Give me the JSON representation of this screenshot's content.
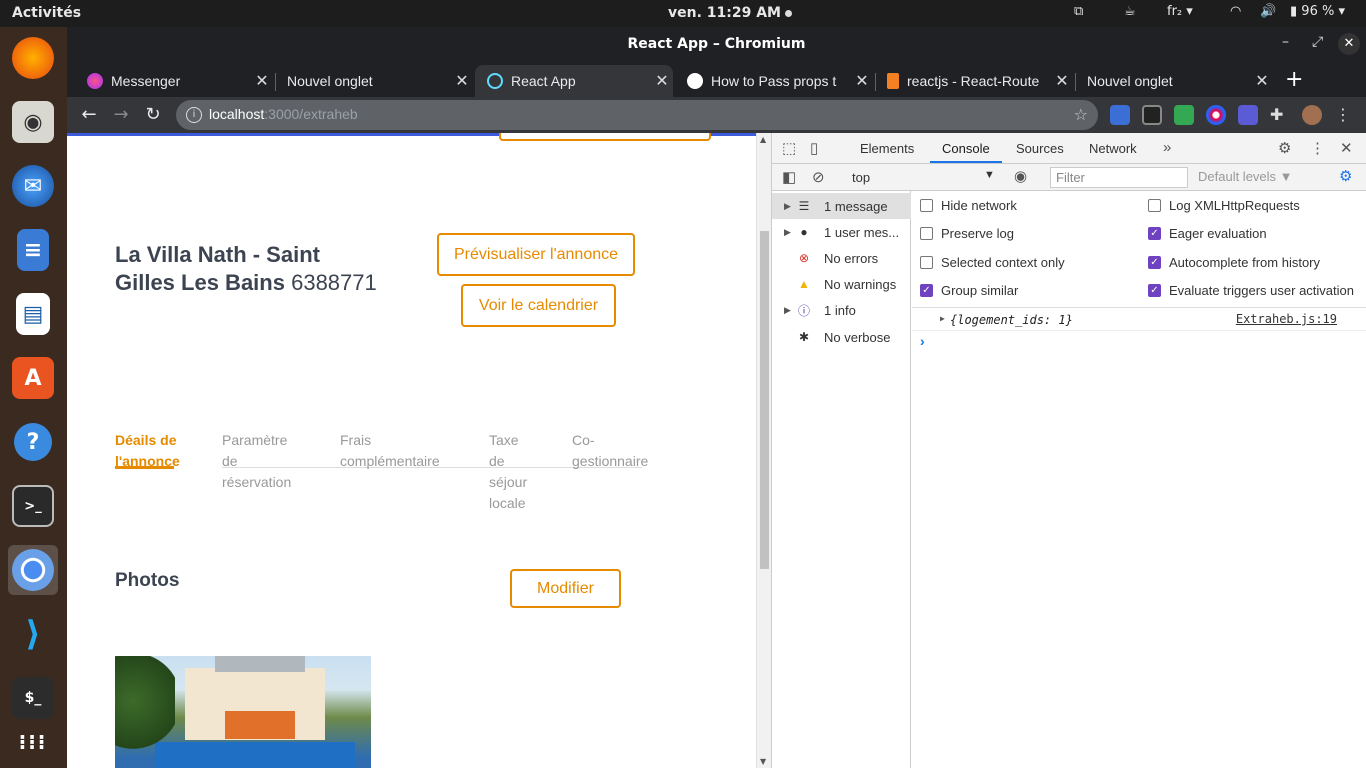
{
  "system": {
    "activities": "Activités",
    "clock": "ven. 11:29 AM",
    "keyboard": "fr₂",
    "battery": "96 %"
  },
  "window": {
    "title": "React App – Chromium"
  },
  "tabs": [
    {
      "label": "Messenger",
      "favicon_color": "#a033ff"
    },
    {
      "label": "Nouvel onglet",
      "favicon_color": ""
    },
    {
      "label": "React App",
      "favicon_color": "#61dafb"
    },
    {
      "label": "How to Pass props t",
      "favicon_color": "#ffffff"
    },
    {
      "label": "reactjs - React-Route",
      "favicon_color": "#f48024"
    },
    {
      "label": "Nouvel onglet",
      "favicon_color": ""
    }
  ],
  "omnibox": {
    "host": "localhost",
    "path": ":3000/extraheb"
  },
  "page": {
    "title_line1": "La Villa Nath - Saint",
    "title_line2": "Gilles Les Bains",
    "listing_id": "6388771",
    "preview_button": "Prévisualiser l'annonce",
    "calendar_button": "Voir le calendrier",
    "tabs": [
      {
        "lines": [
          "Déails de",
          "l'annonce"
        ]
      },
      {
        "lines": [
          "Paramètre",
          "de",
          "réservation"
        ]
      },
      {
        "lines": [
          "",
          "Frais",
          "complémentaire"
        ]
      },
      {
        "lines": [
          "Taxe",
          "de",
          "séjour",
          "locale"
        ]
      },
      {
        "lines": [
          "Co-",
          "gestionnaire"
        ]
      }
    ],
    "photos_heading": "Photos",
    "modify_button": "Modifier"
  },
  "devtools": {
    "tabs": [
      "Elements",
      "Console",
      "Sources",
      "Network"
    ],
    "context": "top",
    "filter_placeholder": "Filter",
    "levels": "Default levels",
    "sidebar": [
      {
        "label": "1 message",
        "icon": "list-icon"
      },
      {
        "label": "1 user mes...",
        "icon": "user-icon"
      },
      {
        "label": "No errors",
        "icon": "error-icon"
      },
      {
        "label": "No warnings",
        "icon": "warning-icon"
      },
      {
        "label": "1 info",
        "icon": "info-icon"
      },
      {
        "label": "No verbose",
        "icon": "bug-icon"
      }
    ],
    "options_left": [
      {
        "label": "Hide network",
        "checked": false
      },
      {
        "label": "Preserve log",
        "checked": false
      },
      {
        "label": "Selected context only",
        "checked": false
      },
      {
        "label": "Group similar",
        "checked": true
      }
    ],
    "options_right": [
      {
        "label": "Log XMLHttpRequests",
        "checked": false
      },
      {
        "label": "Eager evaluation",
        "checked": true
      },
      {
        "label": "Autocomplete from history",
        "checked": true
      },
      {
        "label": "Evaluate triggers user activation",
        "checked": true
      }
    ],
    "log": {
      "text": "{logement_ids: 1}",
      "source": "Extraheb.js:19"
    }
  }
}
